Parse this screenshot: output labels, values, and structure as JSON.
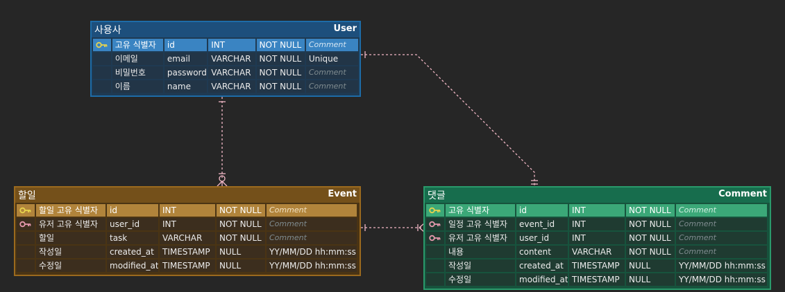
{
  "entities": {
    "user": {
      "logical_name": "사용사",
      "physical_name": "User",
      "rows": [
        {
          "key": "pk",
          "logical": "고유 식별자",
          "physical": "id",
          "type": "INT",
          "nullable": "NOT NULL",
          "comment": "Comment"
        },
        {
          "key": "",
          "logical": "이메일",
          "physical": "email",
          "type": "VARCHAR",
          "nullable": "NOT NULL",
          "comment": "Unique"
        },
        {
          "key": "",
          "logical": "비밀번호",
          "physical": "password",
          "type": "VARCHAR",
          "nullable": "NOT NULL",
          "comment": "Comment"
        },
        {
          "key": "",
          "logical": "이름",
          "physical": "name",
          "type": "VARCHAR",
          "nullable": "NOT NULL",
          "comment": "Comment"
        }
      ]
    },
    "event": {
      "logical_name": "할일",
      "physical_name": "Event",
      "rows": [
        {
          "key": "pk",
          "logical": "할일 고유 식별자",
          "physical": "id",
          "type": "INT",
          "nullable": "NOT NULL",
          "comment": "Comment"
        },
        {
          "key": "fk",
          "logical": "유저 고유 식별자",
          "physical": "user_id",
          "type": "INT",
          "nullable": "NOT NULL",
          "comment": "Comment"
        },
        {
          "key": "",
          "logical": "할일",
          "physical": "task",
          "type": "VARCHAR",
          "nullable": "NOT NULL",
          "comment": "Comment"
        },
        {
          "key": "",
          "logical": "작성일",
          "physical": "created_at",
          "type": "TIMESTAMP",
          "nullable": "NULL",
          "comment": "YY/MM/DD hh:mm:ss"
        },
        {
          "key": "",
          "logical": "수정일",
          "physical": "modified_at",
          "type": "TIMESTAMP",
          "nullable": "NULL",
          "comment": "YY/MM/DD hh:mm:ss"
        }
      ]
    },
    "comment": {
      "logical_name": "댓글",
      "physical_name": "Comment",
      "rows": [
        {
          "key": "pk",
          "logical": "고유 식별자",
          "physical": "id",
          "type": "INT",
          "nullable": "NOT NULL",
          "comment": "Comment"
        },
        {
          "key": "fk",
          "logical": "일정 고유 식별자",
          "physical": "event_id",
          "type": "INT",
          "nullable": "NOT NULL",
          "comment": "Comment"
        },
        {
          "key": "fk",
          "logical": "유저 고유 식별자",
          "physical": "user_id",
          "type": "INT",
          "nullable": "NOT NULL",
          "comment": "Comment"
        },
        {
          "key": "",
          "logical": "내용",
          "physical": "content",
          "type": "VARCHAR",
          "nullable": "NOT NULL",
          "comment": "Comment"
        },
        {
          "key": "",
          "logical": "작성일",
          "physical": "created_at",
          "type": "TIMESTAMP",
          "nullable": "NULL",
          "comment": "YY/MM/DD hh:mm:ss"
        },
        {
          "key": "",
          "logical": "수정일",
          "physical": "modified_at",
          "type": "TIMESTAMP",
          "nullable": "NULL",
          "comment": "YY/MM/DD hh:mm:ss"
        }
      ]
    }
  },
  "relationships": [
    {
      "from": "User",
      "to": "Event",
      "style": "one-to-zero-or-many"
    },
    {
      "from": "User",
      "to": "Comment",
      "style": "one-to-one"
    },
    {
      "from": "Event",
      "to": "Comment",
      "style": "one-to-one-or-many"
    }
  ],
  "colors": {
    "relationship_line": "#f2b8c6",
    "pk_icon": "#e8d44d",
    "fk_icon": "#e79aae",
    "background": "#262626"
  }
}
